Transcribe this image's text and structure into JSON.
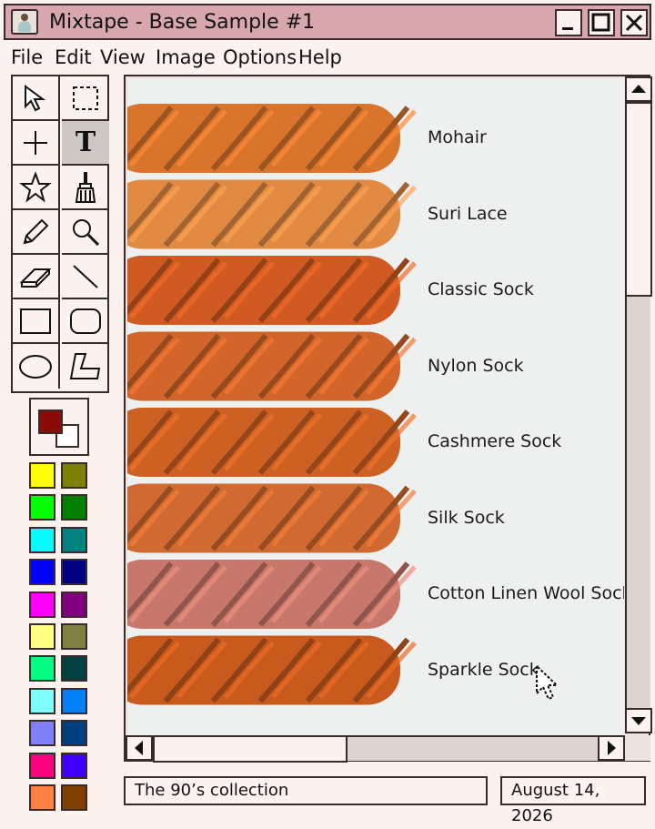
{
  "window": {
    "title": "Mixtape - Base Sample #1"
  },
  "menu": [
    "File",
    "Edit",
    "View",
    "Image",
    "Options",
    "Help"
  ],
  "tools": [
    "select-arrow-icon",
    "dashed-select-icon",
    "crosshair-icon",
    "text-icon",
    "star-icon",
    "brush-icon",
    "pencil-icon",
    "magnifier-icon",
    "eraser-icon",
    "line-icon",
    "rectangle-icon",
    "rounded-rectangle-icon",
    "ellipse-icon",
    "polygon-icon"
  ],
  "tool_text_glyph": "T",
  "selected_colors": {
    "primary": "#8b0a0a",
    "secondary": "#ffffff"
  },
  "palette": [
    "#ffff00",
    "#808000",
    "#00ff00",
    "#008000",
    "#00ffff",
    "#008080",
    "#0000ff",
    "#000080",
    "#ff00ff",
    "#800080",
    "#ffff80",
    "#808040",
    "#00ff80",
    "#004040",
    "#80ffff",
    "#0080ff",
    "#8080ff",
    "#004080",
    "#ff0080",
    "#4000ff",
    "#ff8040",
    "#804000"
  ],
  "yarn_samples": [
    {
      "label": "Mohair",
      "color": "#d8742c"
    },
    {
      "label": "Suri Lace",
      "color": "#e08a44"
    },
    {
      "label": "Classic Sock",
      "color": "#cf5a22"
    },
    {
      "label": "Nylon Sock",
      "color": "#d2662a"
    },
    {
      "label": "Cashmere Sock",
      "color": "#cd6124"
    },
    {
      "label": "Silk Sock",
      "color": "#d06a30"
    },
    {
      "label": "Cotton Linen Wool Sock",
      "color": "#c8786a"
    },
    {
      "label": "Sparkle Sock",
      "color": "#c95a1e"
    }
  ],
  "status": {
    "collection": "The 90’s collection",
    "date": "August 14, 2026"
  }
}
